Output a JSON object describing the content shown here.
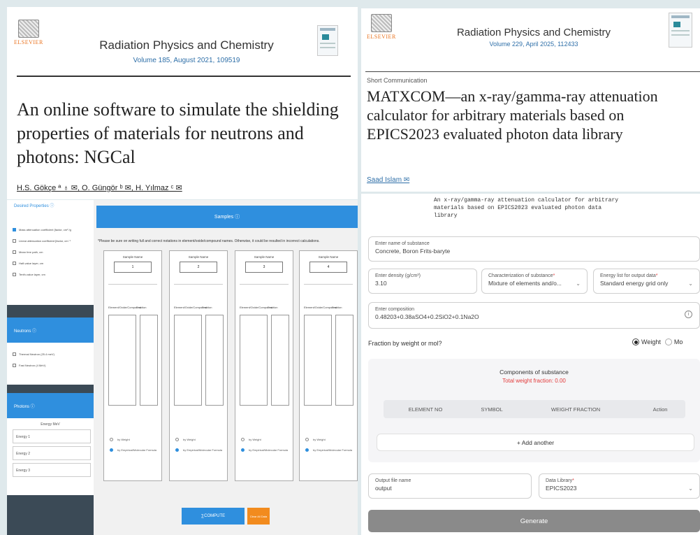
{
  "ngcal_article": {
    "publisher": "ELSEVIER",
    "journal": "Radiation Physics and Chemistry",
    "volume_line": "Volume 185, August 2021, 109519",
    "title": "An online software to simulate the shielding properties of materials for neutrons and photons: NGCal",
    "authors": "H.S. Gökçe ª ♁ ✉, O. Güngör ᵇ ✉, H. Yılmaz ᶜ ✉"
  },
  "matx_article": {
    "publisher": "ELSEVIER",
    "journal": "Radiation Physics and Chemistry",
    "volume_line": "Volume 229, April 2025, 112433",
    "article_type": "Short Communication",
    "title": "MATXCOM—an x-ray/gamma-ray attenuation calculator for arbitrary materials based on EPICS2023 evaluated photon data library",
    "author": "Saad Islam ✉"
  },
  "ngcal_app": {
    "sidebar": {
      "desired_properties_label": "Desired Properties ⓘ",
      "properties": [
        {
          "label": "Mass attenuation coefficient [factor, cm² /g",
          "checked": true
        },
        {
          "label": "Linear attenuation coefficient [factor, cm⁻¹",
          "checked": false
        },
        {
          "label": "Mean free path, cm",
          "checked": false
        },
        {
          "label": "Half-value layer, cm",
          "checked": false
        },
        {
          "label": "Tenth-value layer, cm",
          "checked": false
        }
      ],
      "neutrons_label": "Neutrons ⓘ",
      "neutrons": [
        {
          "label": "Thermal Neutron (25.4 meV)",
          "checked": false
        },
        {
          "label": "Fast Neutron (4 MeV)",
          "checked": false
        }
      ],
      "photons_label": "Photons ⓘ",
      "energy_title": "Energy MeV",
      "energies": [
        "Energy 1",
        "Energy 2",
        "Energy 3"
      ]
    },
    "samples_label": "Samples ⓘ",
    "note": "*Please be sure on writing full and correct notations in element/oxide/compound names. Otherwise, it could be resulted in incorrect calculations.",
    "sample_name_label": "Sample Name",
    "column_compound": "Element/Oxide/Compound",
    "column_fraction": "Fraction",
    "radio_weight": "by Weight",
    "radio_formula": "by Empirical/Molecular Formula",
    "samples": [
      "1",
      "2",
      "3",
      "4"
    ],
    "compute_label": "∑COMPUTE",
    "clear_label": "Clear All Data"
  },
  "matx_app": {
    "banner": "An x-ray/gamma-ray attenuation calculator for arbitrary\nmaterials based on EPICS2023 evaluated photon data\nlibrary",
    "substance_name_label": "Enter name of substance",
    "substance_name_value": "Concrete, Boron Frits-baryte",
    "density_label": "Enter density (g/cm³)",
    "density_value": "3.10",
    "characterization_label": "Characterization of substance",
    "characterization_value": "Mixture of elements and/o...",
    "energy_list_label": "Energy list for output data",
    "energy_list_value": "Standard energy grid only",
    "composition_label": "Enter composition",
    "composition_value": "0.48203+0.38aSO4+0.2SiO2+0.1Na2O",
    "fraction_question": "Fraction by weight or mol?",
    "weight_label": "Weight",
    "mol_label": "Mo",
    "components_title": "Components of substance",
    "total_weight": "Total weight fraction: 0.00",
    "table_headers": [
      "ELEMENT NO",
      "SYMBOL",
      "WEIGHT FRACTION",
      "Action"
    ],
    "add_another": "+ Add another",
    "output_label": "Output file name",
    "output_value": "output",
    "library_label": "Data Library",
    "library_value": "EPICS2023",
    "generate_label": "Generate",
    "required_mark": "*",
    "chevron": "⌄",
    "info_icon": "i"
  }
}
